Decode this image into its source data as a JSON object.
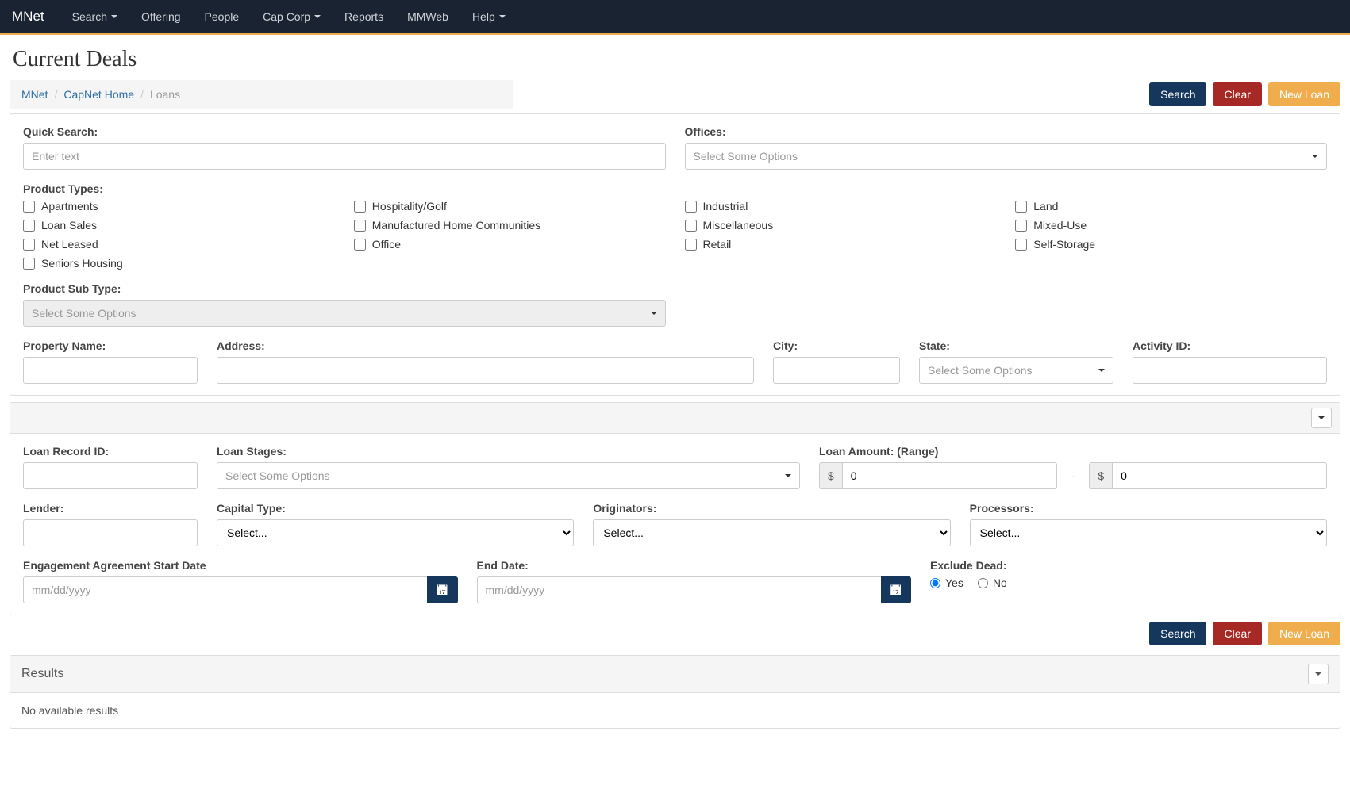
{
  "nav": {
    "brand": "MNet",
    "items": [
      {
        "label": "Search",
        "dropdown": true
      },
      {
        "label": "Offering",
        "dropdown": false
      },
      {
        "label": "People",
        "dropdown": false
      },
      {
        "label": "Cap Corp",
        "dropdown": true
      },
      {
        "label": "Reports",
        "dropdown": false
      },
      {
        "label": "MMWeb",
        "dropdown": false
      },
      {
        "label": "Help",
        "dropdown": true
      }
    ]
  },
  "page_title": "Current Deals",
  "breadcrumb": {
    "items": [
      {
        "label": "MNet",
        "link": true
      },
      {
        "label": "CapNet Home",
        "link": true
      },
      {
        "label": "Loans",
        "link": false
      }
    ]
  },
  "buttons": {
    "search": "Search",
    "clear": "Clear",
    "new_loan": "New Loan"
  },
  "section1": {
    "quick_search": {
      "label": "Quick Search:",
      "placeholder": "Enter text"
    },
    "offices": {
      "label": "Offices:",
      "placeholder": "Select Some Options"
    },
    "product_types": {
      "label": "Product Types:",
      "options": [
        "Apartments",
        "Hospitality/Golf",
        "Industrial",
        "Land",
        "Loan Sales",
        "Manufactured Home Communities",
        "Miscellaneous",
        "Mixed-Use",
        "Net Leased",
        "Office",
        "Retail",
        "Self-Storage",
        "Seniors Housing"
      ]
    },
    "product_sub_type": {
      "label": "Product Sub Type:",
      "placeholder": "Select Some Options"
    },
    "property_name": {
      "label": "Property Name:"
    },
    "address": {
      "label": "Address:"
    },
    "city": {
      "label": "City:"
    },
    "state": {
      "label": "State:",
      "placeholder": "Select Some Options"
    },
    "activity_id": {
      "label": "Activity ID:"
    }
  },
  "section2": {
    "loan_record_id": {
      "label": "Loan Record ID:"
    },
    "loan_stages": {
      "label": "Loan Stages:",
      "placeholder": "Select Some Options"
    },
    "loan_amount": {
      "label": "Loan Amount: (Range)",
      "prefix": "$",
      "from": "0",
      "to": "0",
      "sep": "-"
    },
    "lender": {
      "label": "Lender:"
    },
    "capital_type": {
      "label": "Capital Type:",
      "placeholder": "Select..."
    },
    "originators": {
      "label": "Originators:",
      "placeholder": "Select..."
    },
    "processors": {
      "label": "Processors:",
      "placeholder": "Select..."
    },
    "start_date": {
      "label": "Engagement Agreement Start Date",
      "placeholder": "mm/dd/yyyy"
    },
    "end_date": {
      "label": "End Date:",
      "placeholder": "mm/dd/yyyy"
    },
    "exclude_dead": {
      "label": "Exclude Dead:",
      "yes": "Yes",
      "no": "No",
      "value": "yes"
    }
  },
  "results": {
    "title": "Results",
    "empty": "No available results"
  }
}
